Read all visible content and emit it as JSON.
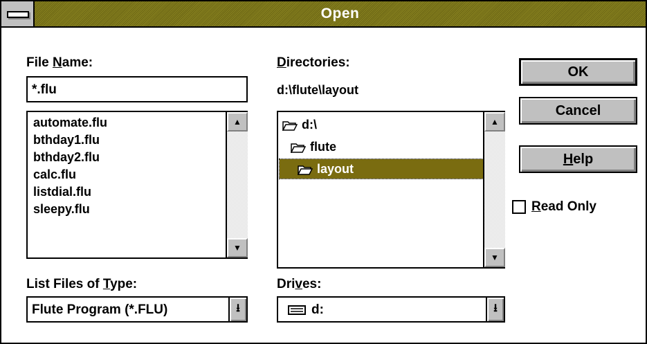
{
  "window": {
    "title": "Open"
  },
  "file_name": {
    "label_before": "File ",
    "label_mnemonic": "N",
    "label_after": "ame:",
    "value": "*.flu",
    "files": [
      "automate.flu",
      "bthday1.flu",
      "bthday2.flu",
      "calc.flu",
      "listdial.flu",
      "sleepy.flu"
    ]
  },
  "directories": {
    "label_mnemonic": "D",
    "label_after": "irectories:",
    "current_path": "d:\\flute\\layout",
    "items": [
      {
        "name": "d:\\",
        "state": "open"
      },
      {
        "name": "flute",
        "state": "open"
      },
      {
        "name": "layout",
        "state": "open",
        "selected": true
      }
    ]
  },
  "file_type": {
    "label_before": "List Files of ",
    "label_mnemonic": "T",
    "label_after": "ype:",
    "value": "Flute Program (*.FLU)"
  },
  "drives": {
    "label_before": "Dri",
    "label_mnemonic": "v",
    "label_after": "es:",
    "value": "d:"
  },
  "buttons": {
    "ok": "OK",
    "cancel": "Cancel",
    "help_mnemonic": "H",
    "help_rest": "elp"
  },
  "read_only": {
    "label_mnemonic": "R",
    "label_rest": "ead Only",
    "checked": false
  },
  "icons": {
    "scroll_up": "▲",
    "scroll_down": "▼",
    "combo_arrow": "⭳"
  },
  "colors": {
    "titlebar": "#77701a",
    "selection": "#7a6c10",
    "button_face": "#c0c0c0"
  }
}
